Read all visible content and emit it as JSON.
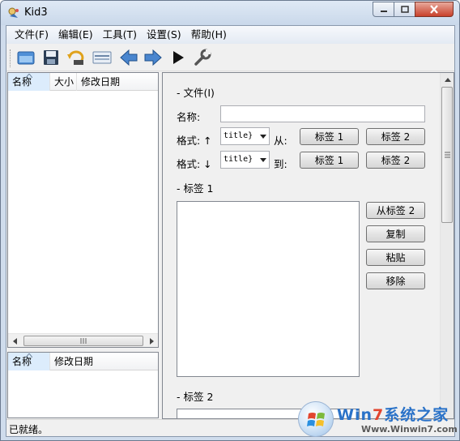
{
  "window": {
    "title": "Kid3"
  },
  "menu": {
    "items": [
      {
        "label": "文件(F)"
      },
      {
        "label": "编辑(E)"
      },
      {
        "label": "工具(T)"
      },
      {
        "label": "设置(S)"
      },
      {
        "label": "帮助(H)"
      }
    ]
  },
  "toolbar": {
    "buttons": [
      {
        "icon": "open-folder-icon"
      },
      {
        "icon": "save-icon"
      },
      {
        "icon": "revert-icon"
      },
      {
        "icon": "filter-icon"
      },
      {
        "icon": "previous-arrow-icon"
      },
      {
        "icon": "next-arrow-icon"
      },
      {
        "icon": "play-icon"
      },
      {
        "icon": "settings-wrench-icon"
      }
    ]
  },
  "file_list": {
    "columns": [
      "名称",
      "大小",
      "修改日期"
    ]
  },
  "dir_list": {
    "columns": [
      "名称",
      "修改日期"
    ]
  },
  "file_section": {
    "header": "-  文件(I)",
    "name_label": "名称:",
    "name_value": "",
    "format_up_label": "格式: ↑",
    "format_up_value": "title}",
    "from_label": "从:",
    "from_tag1": "标签 1",
    "from_tag2": "标签 2",
    "format_down_label": "格式: ↓",
    "format_down_value": "title}",
    "to_label": "到:",
    "to_tag1": "标签 1",
    "to_tag2": "标签 2"
  },
  "tag1_section": {
    "header": "-  标签 1",
    "from_tag2_button": "从标签 2",
    "copy_button": "复制",
    "paste_button": "粘贴",
    "remove_button": "移除"
  },
  "tag2_section": {
    "header": "-  标签 2"
  },
  "status": {
    "text": "已就绪。"
  },
  "watermark": {
    "text1_a": "Win",
    "text1_b": "7",
    "text1_c": "系统之家",
    "text2": "Www.Winwin7.com"
  }
}
